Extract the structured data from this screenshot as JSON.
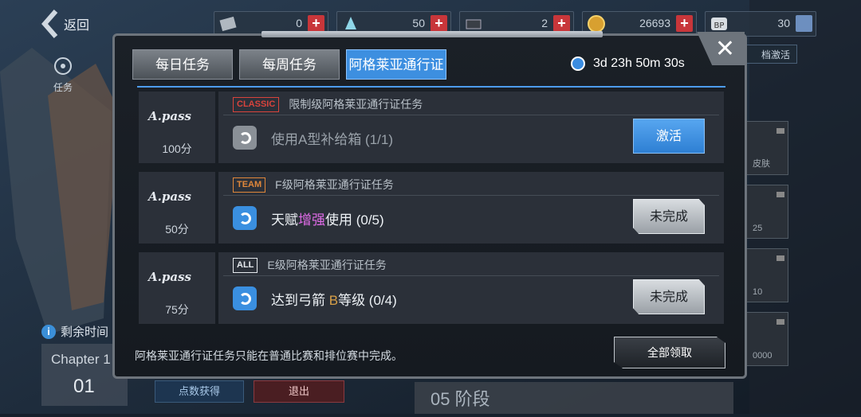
{
  "topbar": {
    "back_label": "返回",
    "resources": [
      {
        "icon": "cards-icon",
        "value": "0",
        "action": "plus"
      },
      {
        "icon": "crystal-icon",
        "value": "50",
        "action": "plus"
      },
      {
        "icon": "ticket-icon",
        "value": "2",
        "action": "plus"
      },
      {
        "icon": "gold-coin-icon",
        "value": "26693",
        "action": "plus"
      },
      {
        "icon": "bp-icon",
        "value": "30",
        "action": "book"
      }
    ]
  },
  "background": {
    "task_label": "任务",
    "remaining_label": "剩余时间",
    "chapter_label": "Chapter 1",
    "chapter_number": "01",
    "points_button": "点数获得",
    "exit_button": "退出",
    "stage_label": "05 阶段",
    "activate_label": "档激活",
    "side_labels": [
      "皮肤",
      "25",
      "10",
      "0000"
    ]
  },
  "modal": {
    "tabs": [
      {
        "label": "每日任务",
        "active": false
      },
      {
        "label": "每周任务",
        "active": false
      },
      {
        "label": "阿格莱亚通行证",
        "active": true
      }
    ],
    "timer": "3d 23h 50m 30s",
    "missions": [
      {
        "logo": "A.pass",
        "points": "100分",
        "badge": "CLASSIC",
        "badge_color": "#d9433c",
        "title": "限制级阿格莱亚通行证任务",
        "icon_style": "gray",
        "task_parts": [
          {
            "text": "使用A型补给箱 (1/1)",
            "color": "#9aa2aa"
          }
        ],
        "button": "激活",
        "button_style": "blue"
      },
      {
        "logo": "A.pass",
        "points": "50分",
        "badge": "TEAM",
        "badge_color": "#e0873a",
        "title": "F级阿格莱亚通行证任务",
        "icon_style": "blue",
        "task_parts": [
          {
            "text": "天赋",
            "color": "#eef2f6"
          },
          {
            "text": "增强",
            "color": "#e06ce8"
          },
          {
            "text": "使用 (0/5)",
            "color": "#eef2f6"
          }
        ],
        "button": "未完成",
        "button_style": "gray"
      },
      {
        "logo": "A.pass",
        "points": "75分",
        "badge": "ALL",
        "badge_color": "#e6eaee",
        "title": "E级阿格莱亚通行证任务",
        "icon_style": "blue",
        "task_parts": [
          {
            "text": "达到弓箭 ",
            "color": "#eef2f6"
          },
          {
            "text": "B",
            "color": "#d8a048"
          },
          {
            "text": "等级 (0/4)",
            "color": "#eef2f6"
          }
        ],
        "button": "未完成",
        "button_style": "gray"
      }
    ],
    "footer_note": "阿格莱亚通行证任务只能在普通比赛和排位赛中完成。",
    "claim_all": "全部领取"
  }
}
